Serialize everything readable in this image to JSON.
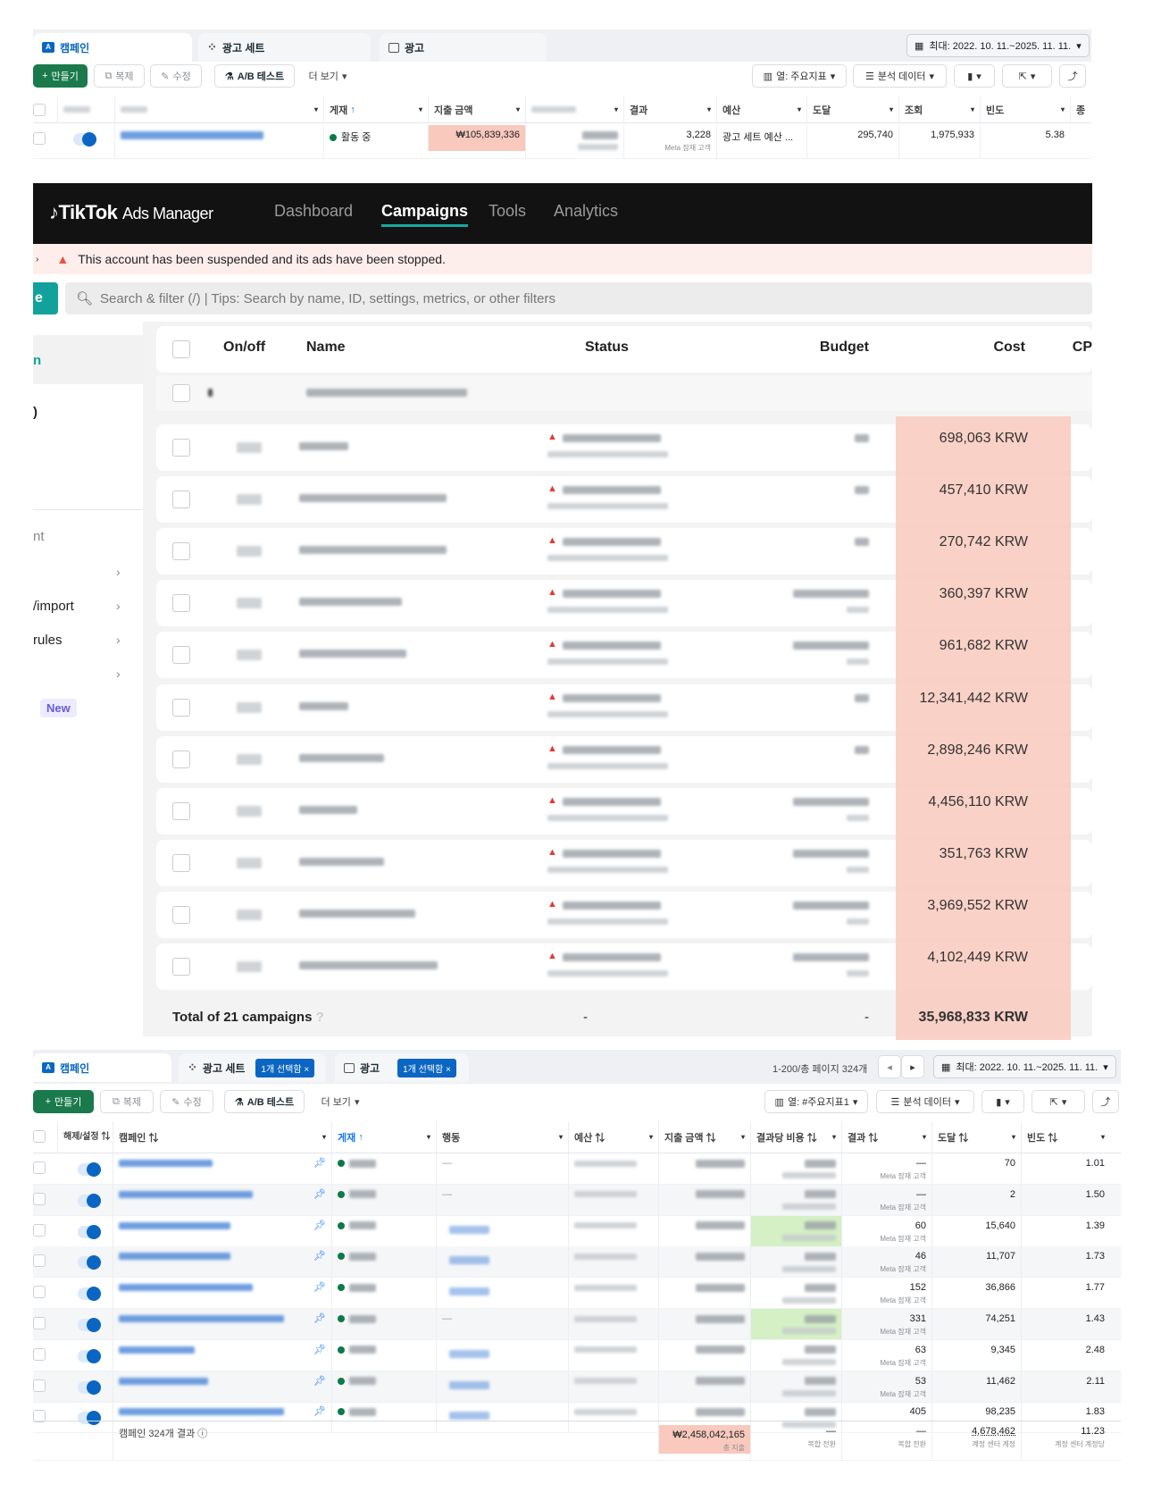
{
  "meta_top": {
    "tabs": [
      "캠페인",
      "광고 세트",
      "광고"
    ],
    "date_range": "최대: 2022. 10. 11.~2025. 11. 11.",
    "toolbar": {
      "create": "만들기",
      "duplicate": "복제",
      "edit": "수정",
      "ab_test": "A/B 테스트",
      "more": "더 보기",
      "columns": "열: 주요지표",
      "breakdown": "분석 데이터"
    },
    "columns": [
      "캠페인",
      "게재",
      "지출 금액",
      "결과",
      "예산",
      "도달",
      "조회",
      "빈도",
      "종"
    ],
    "row": {
      "delivery": "활동 중",
      "spend": "₩105,839,336",
      "results": "3,228",
      "results_sub": "Meta 잠재 고객",
      "budget": "광고 세트 예산 ...",
      "reach": "295,740",
      "impressions": "1,975,933",
      "frequency": "5.38"
    }
  },
  "tiktok": {
    "brand": "TikTok",
    "product": "Ads Manager",
    "nav": [
      "Dashboard",
      "Campaigns",
      "Tools",
      "Analytics"
    ],
    "alert": "This account has been suspended and its ads have been stopped.",
    "create_fragment": "e",
    "search_placeholder": "Search & filter (/) | Tips: Search by name, ID, settings, metrics, or other filters",
    "sidebar": {
      "items": [
        "n",
        ")",
        "nt",
        "/import",
        "rules"
      ],
      "new_badge": "New"
    },
    "columns": {
      "onoff": "On/off",
      "name": "Name",
      "status": "Status",
      "budget": "Budget",
      "cost": "Cost",
      "cpc": "CP"
    },
    "costs": [
      "698,063 KRW",
      "457,410 KRW",
      "270,742 KRW",
      "360,397 KRW",
      "961,682 KRW",
      "12,341,442 KRW",
      "2,898,246 KRW",
      "4,456,110 KRW",
      "351,763 KRW",
      "3,969,552 KRW",
      "4,102,449 KRW"
    ],
    "total": {
      "label": "Total of 21 campaigns",
      "status": "-",
      "budget": "-",
      "cost": "35,968,833 KRW"
    },
    "highlight_color": "#f9c9bd"
  },
  "meta_bottom": {
    "tabs": [
      "캠페인",
      "광고 세트",
      "광고"
    ],
    "selected_pill": "1개 선택함",
    "pagination": "1-200/총 페이지 324개",
    "date_range": "최대: 2022. 10. 11.~2025. 11. 11.",
    "toolbar": {
      "create": "만들기",
      "duplicate": "복제",
      "edit": "수정",
      "ab_test": "A/B 테스트",
      "more": "더 보기",
      "columns": "열: #주요지표1",
      "breakdown": "분석 데이터"
    },
    "columns": [
      "해제/설정 ⇅",
      "캠페인 ⇅",
      "게재",
      "행동",
      "예산 ⇅",
      "지출 금액 ⇅",
      "결과당 비용 ⇅",
      "결과 ⇅",
      "도달 ⇅",
      "빈도 ⇅"
    ],
    "rows": [
      {
        "results": "—",
        "results_sub": "Meta 잠재 고객",
        "reach": "70",
        "frequency": "1.01"
      },
      {
        "results": "—",
        "results_sub": "Meta 잠재 고객",
        "reach": "2",
        "frequency": "1.50"
      },
      {
        "results": "60",
        "results_sub": "Meta 잠재 고객",
        "reach": "15,640",
        "frequency": "1.39"
      },
      {
        "results": "46",
        "results_sub": "Meta 잠재 고객",
        "reach": "11,707",
        "frequency": "1.73"
      },
      {
        "results": "152",
        "results_sub": "Meta 잠재 고객",
        "reach": "36,866",
        "frequency": "1.77"
      },
      {
        "results": "331",
        "results_sub": "Meta 잠재 고객",
        "reach": "74,251",
        "frequency": "1.43"
      },
      {
        "results": "63",
        "results_sub": "Meta 잠재 고객",
        "reach": "9,345",
        "frequency": "2.48"
      },
      {
        "results": "53",
        "results_sub": "Meta 잠재 고객",
        "reach": "11,462",
        "frequency": "2.11"
      },
      {
        "results": "405",
        "results_sub": "",
        "reach": "98,235",
        "frequency": "1.83"
      }
    ],
    "footer": {
      "label": "캠페인 324개 결과",
      "spend": "₩2,458,042,165",
      "spend_sub": "총 지출",
      "cpr": "—",
      "cpr_sub": "복합 전환",
      "results": "—",
      "results_sub": "복합 전환",
      "reach": "4,678,462",
      "reach_sub": "계정 센터 계정",
      "frequency": "11.23",
      "frequency_sub": "계정 센터 계정당"
    },
    "highlight_color": "#f9c9bd",
    "good_color": "#d4f0c4"
  }
}
